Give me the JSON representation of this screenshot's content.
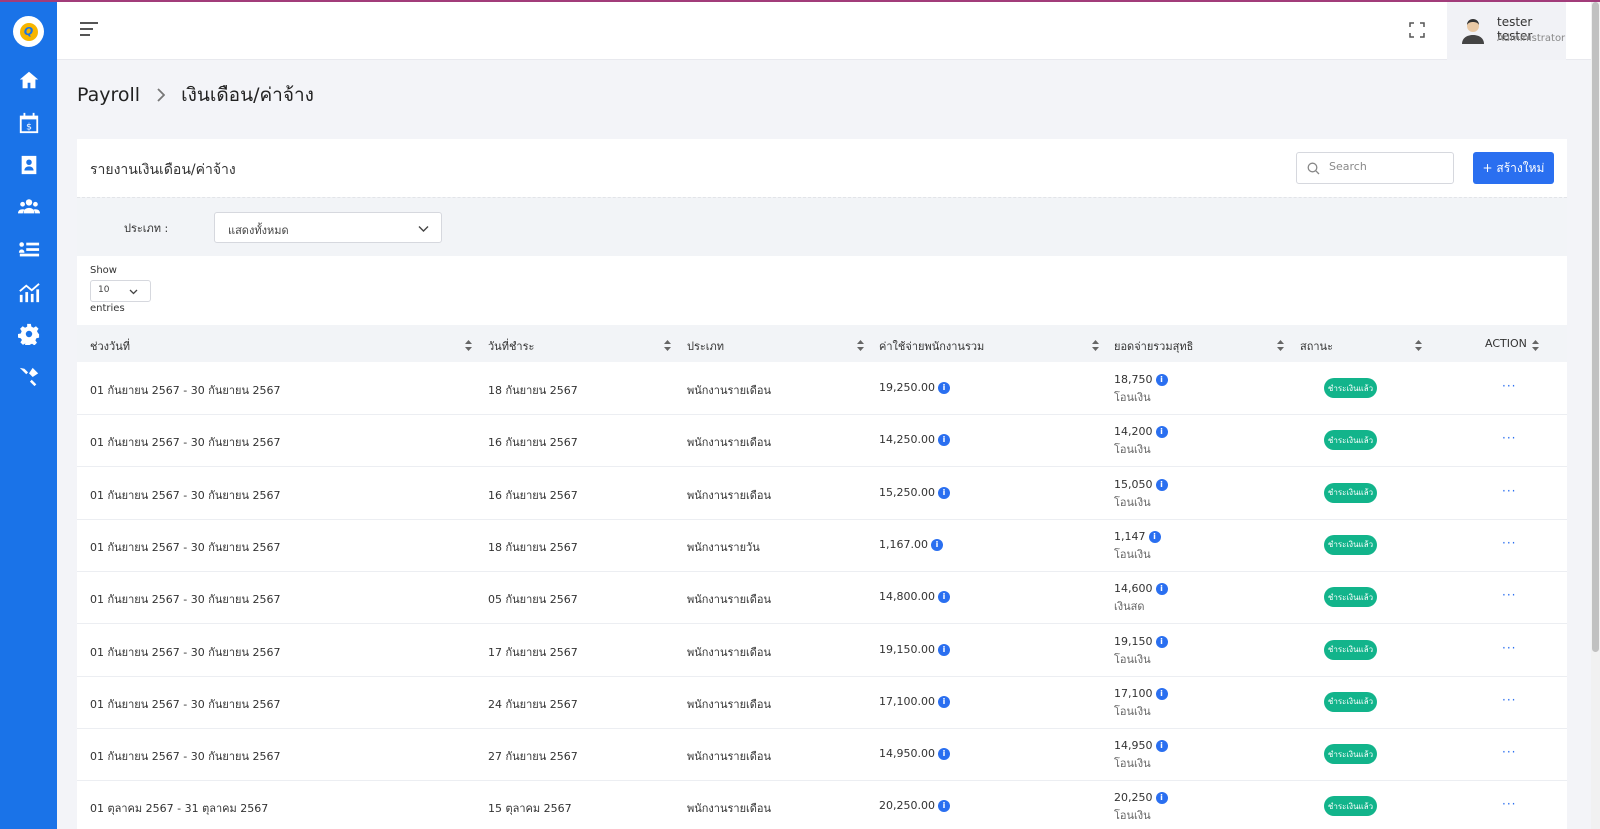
{
  "app": {
    "logo_letter": "Q"
  },
  "sidebar": {
    "items": [
      {
        "icon": "home-icon"
      },
      {
        "icon": "payroll-calendar-icon"
      },
      {
        "icon": "contacts-icon"
      },
      {
        "icon": "team-icon"
      },
      {
        "icon": "list-icon"
      },
      {
        "icon": "chart-icon"
      },
      {
        "icon": "settings-icon"
      },
      {
        "icon": "tools-icon"
      }
    ]
  },
  "topbar": {
    "user_name": "tester tester",
    "user_role": "Administrator"
  },
  "breadcrumb": {
    "parent": "Payroll",
    "current": "เงินเดือน/ค่าจ้าง"
  },
  "card": {
    "title": "รายงานเงินเดือน/ค่าจ้าง",
    "search_placeholder": "Search",
    "create_label": "+  สร้างใหม่"
  },
  "filter": {
    "label": "ประเภท :",
    "value": "แสดงทั้งหมด"
  },
  "pagination": {
    "show_label": "Show",
    "entries_value": "10",
    "entries_label": "entries"
  },
  "table": {
    "columns": [
      "ช่วงวันที่",
      "วันที่ชำระ",
      "ประเภท",
      "ค่าใช้จ่ายพนักงานรวม",
      "ยอดจ่ายรวมสุทธิ",
      "สถานะ",
      "ACTION"
    ],
    "rows": [
      {
        "period": "01 กันยายน 2567 - 30 กันยายน 2567",
        "paid_date": "18 กันยายน 2567",
        "type": "พนักงานรายเดือน",
        "total_cost": "19,250.00",
        "net": "18,750",
        "method": "โอนเงิน",
        "status": "ชำระเงินแล้ว",
        "action": "···"
      },
      {
        "period": "01 กันยายน 2567 - 30 กันยายน 2567",
        "paid_date": "16 กันยายน 2567",
        "type": "พนักงานรายเดือน",
        "total_cost": "14,250.00",
        "net": "14,200",
        "method": "โอนเงิน",
        "status": "ชำระเงินแล้ว",
        "action": "···"
      },
      {
        "period": "01 กันยายน 2567 - 30 กันยายน 2567",
        "paid_date": "16 กันยายน 2567",
        "type": "พนักงานรายเดือน",
        "total_cost": "15,250.00",
        "net": "15,050",
        "method": "โอนเงิน",
        "status": "ชำระเงินแล้ว",
        "action": "···"
      },
      {
        "period": "01 กันยายน 2567 - 30 กันยายน 2567",
        "paid_date": "18 กันยายน 2567",
        "type": "พนักงานรายวัน",
        "total_cost": "1,167.00",
        "net": "1,147",
        "method": "โอนเงิน",
        "status": "ชำระเงินแล้ว",
        "action": "···"
      },
      {
        "period": "01 กันยายน 2567 - 30 กันยายน 2567",
        "paid_date": "05 กันยายน 2567",
        "type": "พนักงานรายเดือน",
        "total_cost": "14,800.00",
        "net": "14,600",
        "method": "เงินสด",
        "status": "ชำระเงินแล้ว",
        "action": "···"
      },
      {
        "period": "01 กันยายน 2567 - 30 กันยายน 2567",
        "paid_date": "17 กันยายน 2567",
        "type": "พนักงานรายเดือน",
        "total_cost": "19,150.00",
        "net": "19,150",
        "method": "โอนเงิน",
        "status": "ชำระเงินแล้ว",
        "action": "···"
      },
      {
        "period": "01 กันยายน 2567 - 30 กันยายน 2567",
        "paid_date": "24 กันยายน 2567",
        "type": "พนักงานรายเดือน",
        "total_cost": "17,100.00",
        "net": "17,100",
        "method": "โอนเงิน",
        "status": "ชำระเงินแล้ว",
        "action": "···"
      },
      {
        "period": "01 กันยายน 2567 - 30 กันยายน 2567",
        "paid_date": "27 กันยายน 2567",
        "type": "พนักงานรายเดือน",
        "total_cost": "14,950.00",
        "net": "14,950",
        "method": "โอนเงิน",
        "status": "ชำระเงินแล้ว",
        "action": "···"
      },
      {
        "period": "01 ตุลาคม 2567 - 31 ตุลาคม 2567",
        "paid_date": "15 ตุลาคม 2567",
        "type": "พนักงานรายเดือน",
        "total_cost": "20,250.00",
        "net": "20,250",
        "method": "โอนเงิน",
        "status": "ชำระเงินแล้ว",
        "action": "···"
      }
    ]
  },
  "colors": {
    "sidebar": "#1a73e8",
    "primary": "#2a6ff0",
    "status_paid": "#12b48b"
  }
}
